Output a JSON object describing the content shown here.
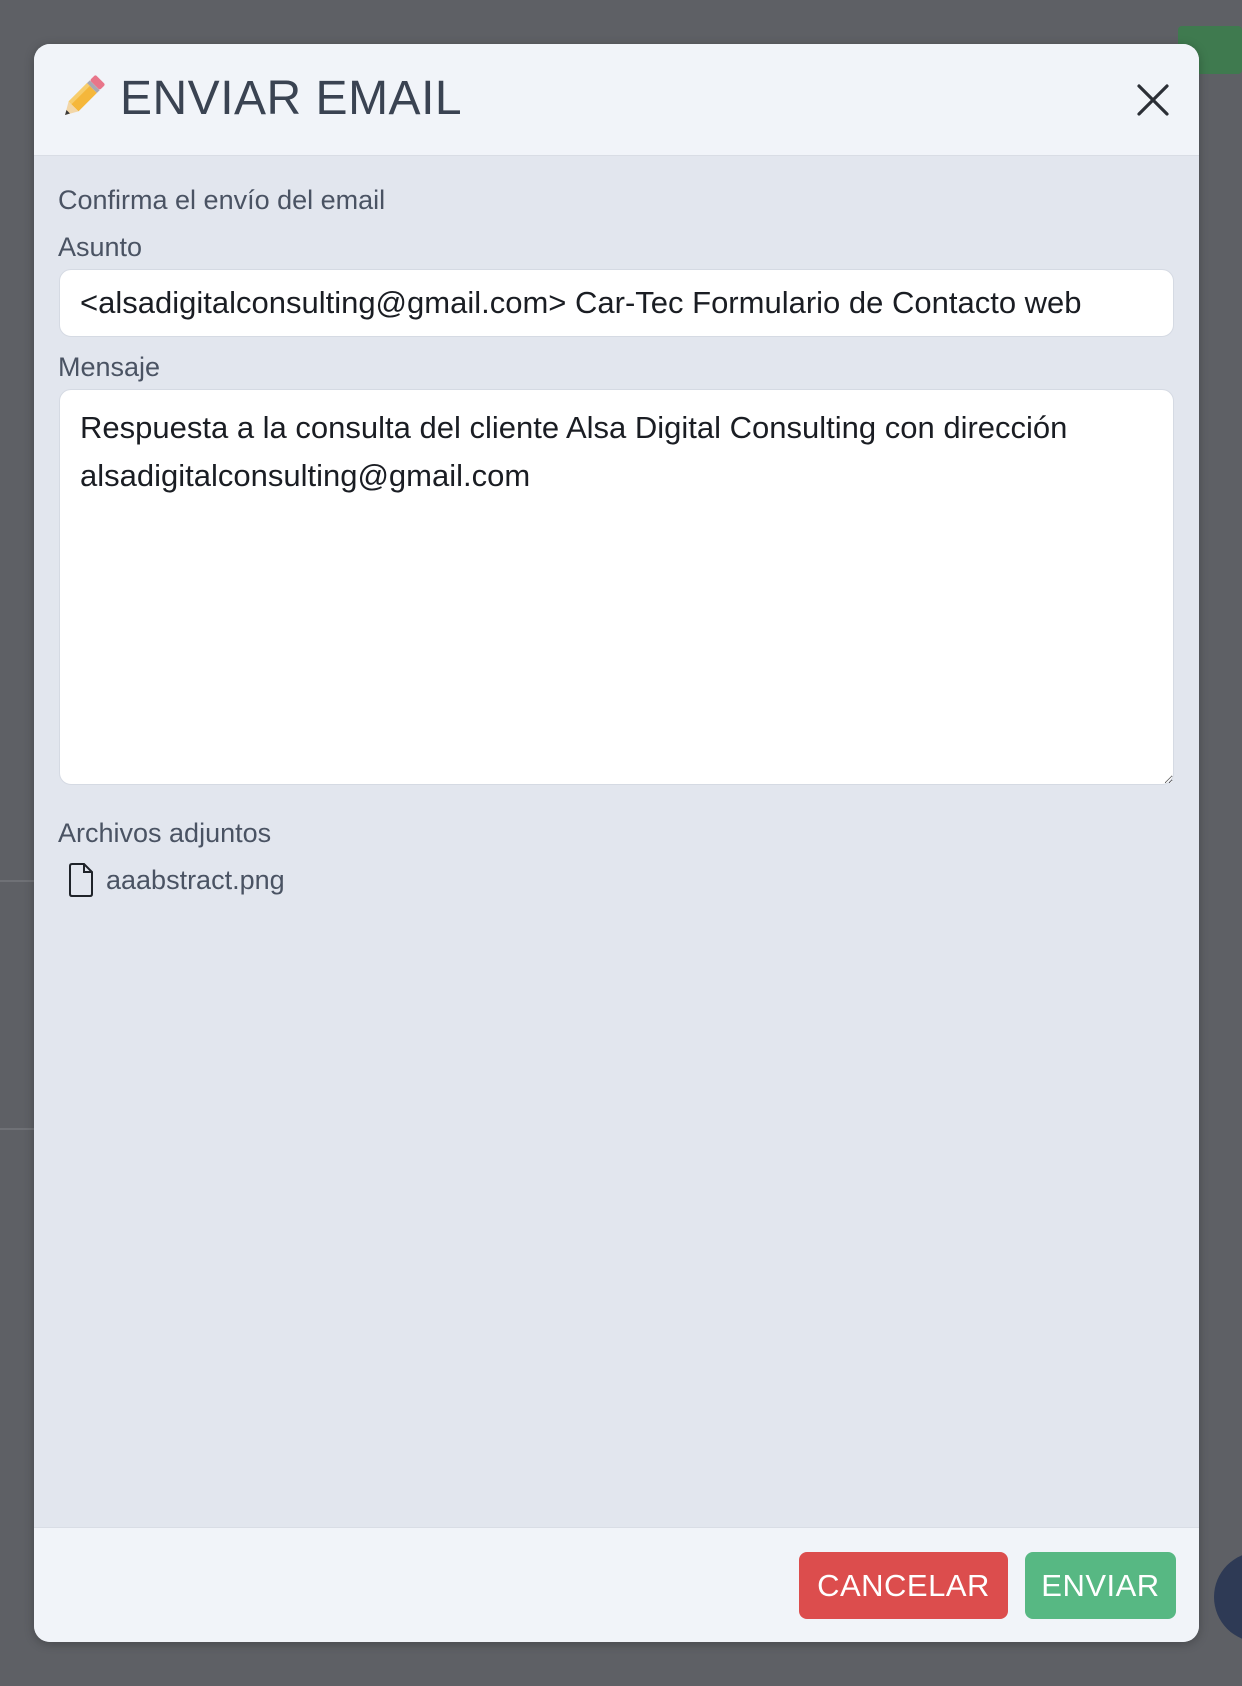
{
  "modal": {
    "title": "ENVIAR EMAIL",
    "title_icon": "pencil-icon",
    "close_icon": "close-icon"
  },
  "form": {
    "confirm_text": "Confirma el envío del email",
    "subject_label": "Asunto",
    "subject_value": "<alsadigitalconsulting@gmail.com> Car-Tec Formulario de Contacto web",
    "message_label": "Mensaje",
    "message_value": "Respuesta a la consulta del cliente Alsa Digital Consulting con dirección alsadigitalconsulting@gmail.com",
    "attachments_label": "Archivos adjuntos",
    "attachments": [
      {
        "name": "aaabstract.png",
        "icon": "file-icon"
      }
    ]
  },
  "footer": {
    "cancel_label": "CANCELAR",
    "send_label": "ENVIAR"
  },
  "colors": {
    "cancel": "#dc4d4d",
    "send": "#57b883",
    "modal_body": "#e2e6ee",
    "modal_header": "#f1f4f9",
    "overlay": "#5e6065"
  }
}
